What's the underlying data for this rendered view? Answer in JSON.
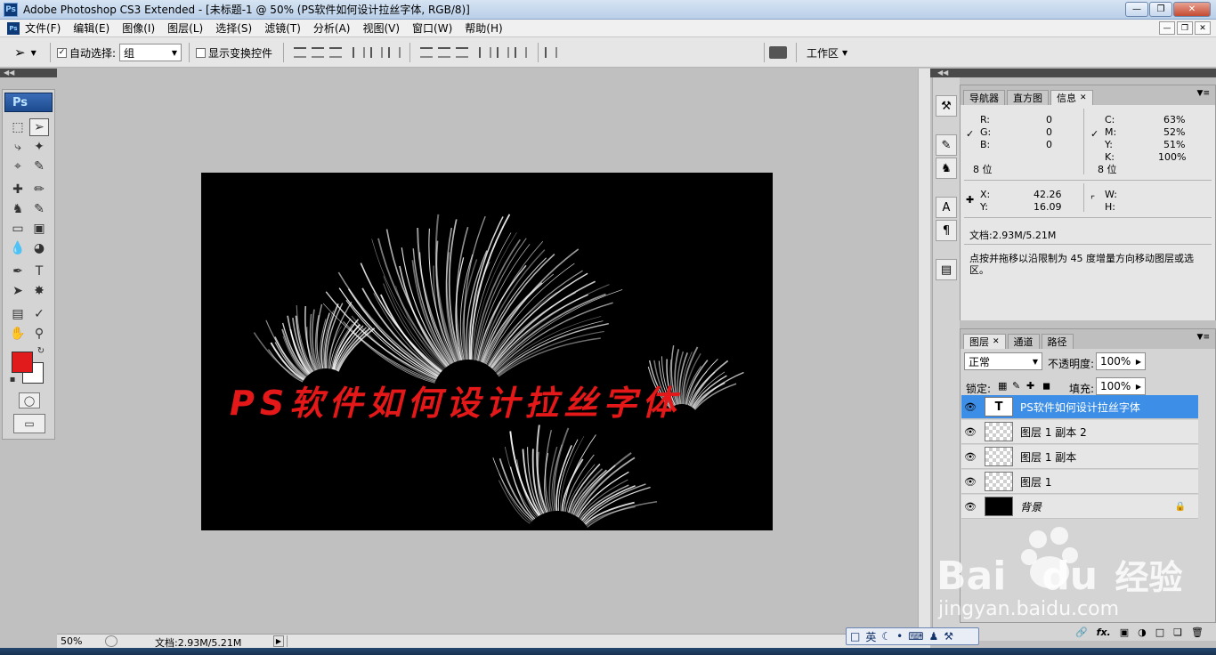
{
  "window": {
    "title": "Adobe Photoshop CS3 Extended - [未标题-1 @ 50% (PS软件如何设计拉丝字体, RGB/8)]"
  },
  "menu": [
    "文件(F)",
    "编辑(E)",
    "图像(I)",
    "图层(L)",
    "选择(S)",
    "滤镜(T)",
    "分析(A)",
    "视图(V)",
    "窗口(W)",
    "帮助(H)"
  ],
  "options": {
    "auto_select_label": "自动选择:",
    "auto_select_checked": true,
    "auto_select_value": "组",
    "show_transform_label": "显示变换控件",
    "show_transform_checked": false,
    "workspace_label": "工作区"
  },
  "toolbox": {
    "badge": "Ps",
    "foreground_color": "#e11b1b",
    "background_color": "#ffffff"
  },
  "canvas": {
    "text": "PS软件如何设计拉丝字体",
    "text_color": "#e41818",
    "background": "#000000"
  },
  "status": {
    "zoom": "50%",
    "doc_info": "文档:2.93M/5.21M"
  },
  "info_panel": {
    "tabs": [
      "导航器",
      "直方图",
      "信息"
    ],
    "active_tab": "信息",
    "rgb": {
      "R_label": "R:",
      "G_label": "G:",
      "B_label": "B:",
      "R": "0",
      "G": "0",
      "B": "0",
      "bits": "8 位"
    },
    "cmyk": {
      "C_label": "C:",
      "M_label": "M:",
      "Y_label": "Y:",
      "K_label": "K:",
      "C": "63%",
      "M": "52%",
      "Y": "51%",
      "K": "100%",
      "bits": "8 位"
    },
    "xy": {
      "X_label": "X:",
      "Y_label": "Y:",
      "X": "42.26",
      "Y": "16.09"
    },
    "wh": {
      "W_label": "W:",
      "H_label": "H:"
    },
    "doc": "文档:2.93M/5.21M",
    "hint": "点按并拖移以沿限制为 45 度增量方向移动图层或选区。"
  },
  "layers_panel": {
    "tabs": [
      "图层",
      "通道",
      "路径"
    ],
    "active_tab": "图层",
    "blend_mode": "正常",
    "opacity_label": "不透明度:",
    "opacity": "100%",
    "lock_label": "锁定:",
    "fill_label": "填充:",
    "fill": "100%",
    "layers": [
      {
        "name": "PS软件如何设计拉丝字体",
        "type": "text",
        "selected": true
      },
      {
        "name": "图层 1 副本 2",
        "type": "pixel",
        "selected": false
      },
      {
        "name": "图层 1 副本",
        "type": "pixel",
        "selected": false
      },
      {
        "name": "图层 1",
        "type": "pixel",
        "selected": false
      },
      {
        "name": "背景",
        "type": "background",
        "selected": false
      }
    ],
    "text_thumb": "T"
  },
  "ime": {
    "lang": "英"
  },
  "watermark": {
    "brand": "Bai",
    "brand2": "du",
    "cn": "经验",
    "url": "jingyan.baidu.com"
  }
}
